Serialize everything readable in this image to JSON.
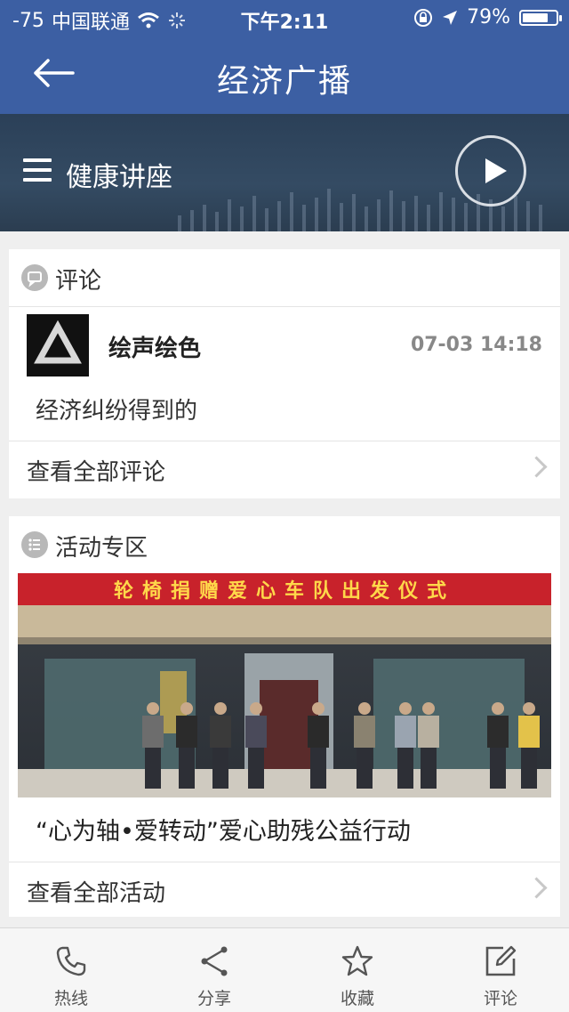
{
  "status_bar": {
    "signal": "-75",
    "carrier": "中国联通",
    "time": "下午2:11",
    "battery": "79%",
    "battery_level": 0.79
  },
  "header": {
    "title": "经济广播"
  },
  "player": {
    "program": "健康讲座"
  },
  "comments": {
    "section_title": "评论",
    "items": [
      {
        "user": "绘声绘色",
        "time": "07-03  14:18",
        "text": "经济纠纷得到的"
      }
    ],
    "more_label": "查看全部评论"
  },
  "activities": {
    "section_title": "活动专区",
    "banner_text": "轮椅捐赠爱心车队出发仪式",
    "caption": "“心为轴•爱转动”爱心助残公益行动",
    "more_label": "查看全部活动"
  },
  "tabbar": {
    "items": [
      {
        "label": "热线",
        "icon": "phone-icon"
      },
      {
        "label": "分享",
        "icon": "share-icon"
      },
      {
        "label": "收藏",
        "icon": "star-icon"
      },
      {
        "label": "评论",
        "icon": "edit-icon"
      }
    ]
  },
  "colors": {
    "header_bg": "#3c5fa3",
    "banner_red": "#c8222b"
  }
}
